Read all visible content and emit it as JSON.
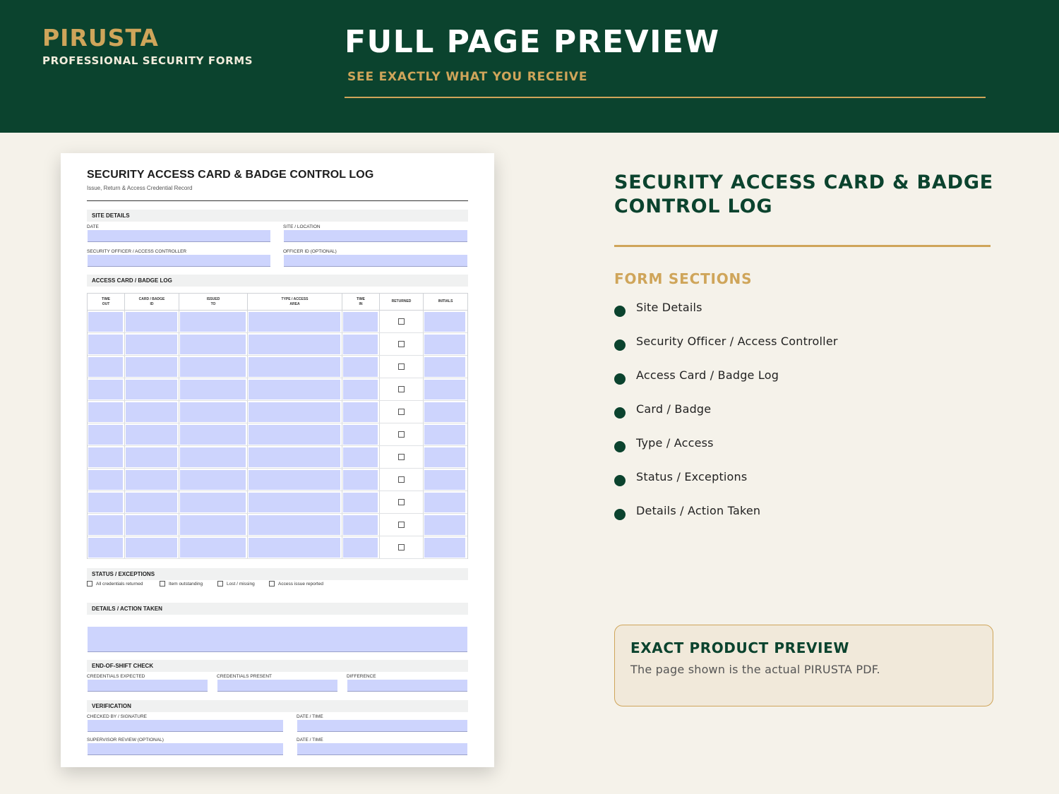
{
  "header": {
    "brand": "PIRUSTA",
    "brand_tagline": "PROFESSIONAL SECURITY FORMS",
    "title": "FULL PAGE PREVIEW",
    "subtitle": "SEE EXACTLY WHAT YOU RECEIVE"
  },
  "colors": {
    "primary": "#0b432e",
    "accent": "#cfa55a",
    "background": "#f5f2ea",
    "field_fill": "#cdd4fd"
  },
  "document": {
    "title": "SECURITY ACCESS CARD & BADGE CONTROL LOG",
    "subtitle": "Issue, Return & Access Credential Record",
    "site_details": {
      "heading": "SITE DETAILS",
      "date_label": "DATE",
      "site_label": "SITE / LOCATION",
      "officer_label": "SECURITY OFFICER / ACCESS CONTROLLER",
      "officer_id_label": "OFFICER ID (OPTIONAL)"
    },
    "log": {
      "heading": "ACCESS CARD / BADGE LOG",
      "columns": [
        {
          "line1": "TIME",
          "line2": "OUT"
        },
        {
          "line1": "CARD / BADGE",
          "line2": "ID"
        },
        {
          "line1": "ISSUED",
          "line2": "TO"
        },
        {
          "line1": "TYPE / ACCESS",
          "line2": "AREA"
        },
        {
          "line1": "TIME",
          "line2": "IN"
        },
        {
          "line1": "RETURNED",
          "line2": ""
        },
        {
          "line1": "INITIALS",
          "line2": ""
        }
      ],
      "row_count": 11
    },
    "status": {
      "heading": "STATUS / EXCEPTIONS",
      "options": [
        "All credentials returned",
        "Item outstanding",
        "Lost / missing",
        "Access issue reported"
      ]
    },
    "details_heading": "DETAILS / ACTION TAKEN",
    "end_of_shift": {
      "heading": "END-OF-SHIFT CHECK",
      "expected_label": "CREDENTIALS EXPECTED",
      "present_label": "CREDENTIALS PRESENT",
      "difference_label": "DIFFERENCE"
    },
    "verification": {
      "heading": "VERIFICATION",
      "checked_by_label": "CHECKED BY / SIGNATURE",
      "date_time_label_1": "DATE / TIME",
      "supervisor_label": "SUPERVISOR REVIEW (OPTIONAL)",
      "date_time_label_2": "DATE / TIME"
    }
  },
  "panel": {
    "title": "SECURITY ACCESS CARD & BADGE CONTROL LOG",
    "sections_heading": "FORM SECTIONS",
    "sections": [
      "Site Details",
      "Security Officer / Access Controller",
      "Access Card / Badge Log",
      "Card / Badge",
      "Type / Access",
      "Status / Exceptions",
      "Details / Action Taken"
    ],
    "preview_title": "EXACT PRODUCT PREVIEW",
    "preview_text": "The page shown is the actual PIRUSTA PDF."
  }
}
